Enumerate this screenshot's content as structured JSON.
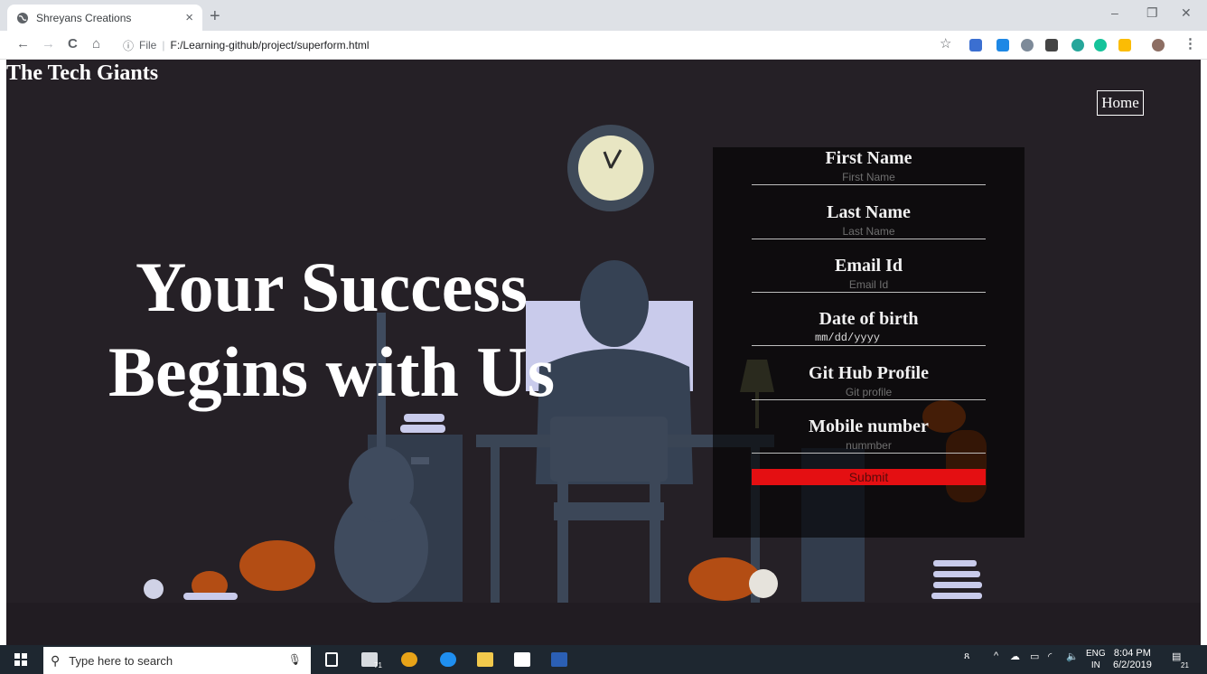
{
  "browser": {
    "tab_title": "Shreyans Creations",
    "tab_close": "×",
    "new_tab": "+",
    "window_controls": {
      "minimize": "–",
      "restore": "❐",
      "close": "✕"
    },
    "nav": {
      "back": "←",
      "forward": "→",
      "reload": "C",
      "home": "⌂"
    },
    "address_scheme": "File",
    "address_sep": "|",
    "address_path": "F:/Learning-github/project/superform.html",
    "star": "☆",
    "menu": "⋮"
  },
  "page": {
    "brand": "The Tech Giants",
    "home_button": "Home",
    "hero_line1": "Your Success",
    "hero_line2": "Begins with Us"
  },
  "form": {
    "fields": [
      {
        "label": "First Name",
        "placeholder": "First Name"
      },
      {
        "label": "Last Name",
        "placeholder": "Last Name"
      },
      {
        "label": "Email Id",
        "placeholder": "Email Id"
      },
      {
        "label": "Date of birth",
        "value": "mm/dd/yyyy"
      },
      {
        "label": "Git Hub Profile",
        "placeholder": "Git profile"
      },
      {
        "label": "Mobile number",
        "placeholder": "nummber"
      }
    ],
    "submit": "Submit"
  },
  "taskbar": {
    "search_placeholder": "Type here to search",
    "lang_top": "ENG",
    "lang_bottom": "IN",
    "time": "8:04 PM",
    "date": "6/2/2019",
    "notification_count": "21",
    "mail_badge": "71"
  }
}
